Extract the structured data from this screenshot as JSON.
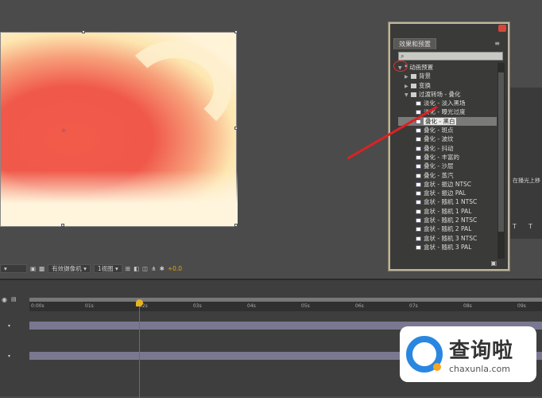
{
  "panel": {
    "tab": "效果和预置",
    "menu_icon": "menu-icon",
    "search_placeholder": "",
    "items": [
      {
        "label": "* 动画预置",
        "type": "root"
      },
      {
        "label": "背景",
        "type": "folder"
      },
      {
        "label": "变换",
        "type": "folder"
      },
      {
        "label": "过渡转场 - 叠化",
        "type": "folder-open"
      },
      {
        "label": "淡化 - 淡入黑场",
        "type": "preset"
      },
      {
        "label": "淡化 - 曝光过度",
        "type": "preset"
      },
      {
        "label": "叠化 - 黑白",
        "type": "preset",
        "selected": true
      },
      {
        "label": "叠化 - 斑点",
        "type": "preset"
      },
      {
        "label": "叠化 - 波纹",
        "type": "preset"
      },
      {
        "label": "叠化 - 抖动",
        "type": "preset"
      },
      {
        "label": "叠化 - 丰富的",
        "type": "preset"
      },
      {
        "label": "叠化 - 沙层",
        "type": "preset"
      },
      {
        "label": "叠化 - 蒸汽",
        "type": "preset"
      },
      {
        "label": "盒状 - 振边 NTSC",
        "type": "preset"
      },
      {
        "label": "盒状 - 振边 PAL",
        "type": "preset"
      },
      {
        "label": "盒状 - 随机 1 NTSC",
        "type": "preset"
      },
      {
        "label": "盒状 - 随机 1 PAL",
        "type": "preset"
      },
      {
        "label": "盒状 - 随机 2 NTSC",
        "type": "preset"
      },
      {
        "label": "盒状 - 随机 2 PAL",
        "type": "preset"
      },
      {
        "label": "盒状 - 随机 3 NTSC",
        "type": "preset"
      },
      {
        "label": "盒状 - 随机 3 PAL",
        "type": "preset"
      }
    ]
  },
  "toolbar": {
    "camera": "有效摄像机",
    "view": "1视图",
    "exposure": "+0.0"
  },
  "timeline": {
    "ticks": [
      "0:00s",
      "01s",
      "02s",
      "03s",
      "04s",
      "05s",
      "06s",
      "07s",
      "08s",
      "09s"
    ]
  },
  "right_panel": {
    "text": "在播光上移",
    "t1": "T",
    "t2": "T"
  },
  "logo": {
    "name": "查询啦",
    "url": "chaxunla.com"
  }
}
